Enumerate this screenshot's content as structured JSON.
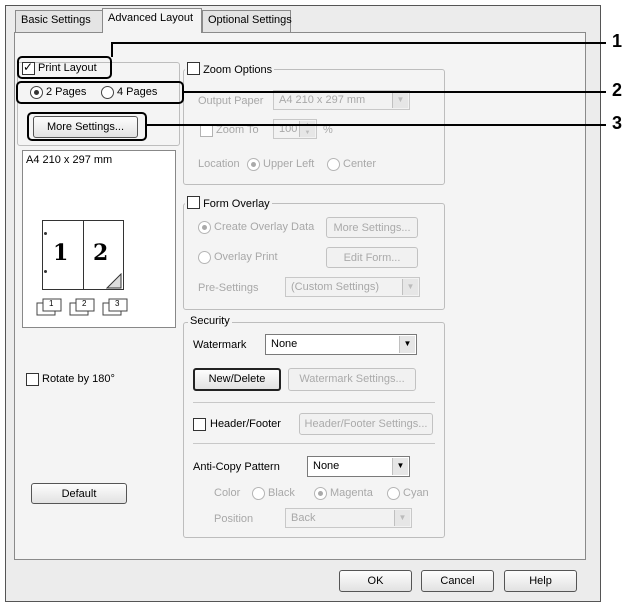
{
  "tabs": [
    "Basic Settings",
    "Advanced Layout",
    "Optional Settings"
  ],
  "print_layout": {
    "label": "Print Layout",
    "checked": true,
    "option_2": "2 Pages",
    "option_4": "4 Pages",
    "more_settings": "More Settings...",
    "paper_label": "A4 210 x 297 mm",
    "page_numbers": [
      "1",
      "2"
    ],
    "stack_digits": [
      "1",
      "2",
      "3"
    ]
  },
  "rotate": {
    "label": "Rotate by 180°"
  },
  "default_button": "Default",
  "zoom": {
    "title": "Zoom Options",
    "output_paper_label": "Output Paper",
    "output_paper_value": "A4 210 x 297 mm",
    "zoom_to_label": "Zoom To",
    "zoom_value": "100",
    "percent": "%",
    "location_label": "Location",
    "upper_left": "Upper Left",
    "center": "Center"
  },
  "form_overlay": {
    "title": "Form Overlay",
    "create": "Create Overlay Data",
    "more_settings": "More Settings...",
    "overlay_print": "Overlay Print",
    "edit_form": "Edit Form...",
    "presettings_label": "Pre-Settings",
    "presettings_value": "(Custom Settings)"
  },
  "security": {
    "title": "Security",
    "watermark_label": "Watermark",
    "watermark_value": "None",
    "new_delete": "New/Delete",
    "watermark_settings": "Watermark Settings...",
    "header_footer": "Header/Footer",
    "header_footer_settings": "Header/Footer Settings...",
    "anti_copy_label": "Anti-Copy Pattern",
    "anti_copy_value": "None",
    "color_label": "Color",
    "black": "Black",
    "magenta": "Magenta",
    "cyan": "Cyan",
    "position_label": "Position",
    "position_value": "Back"
  },
  "footer": {
    "ok": "OK",
    "cancel": "Cancel",
    "help": "Help"
  },
  "callouts": [
    "1",
    "2",
    "3"
  ]
}
